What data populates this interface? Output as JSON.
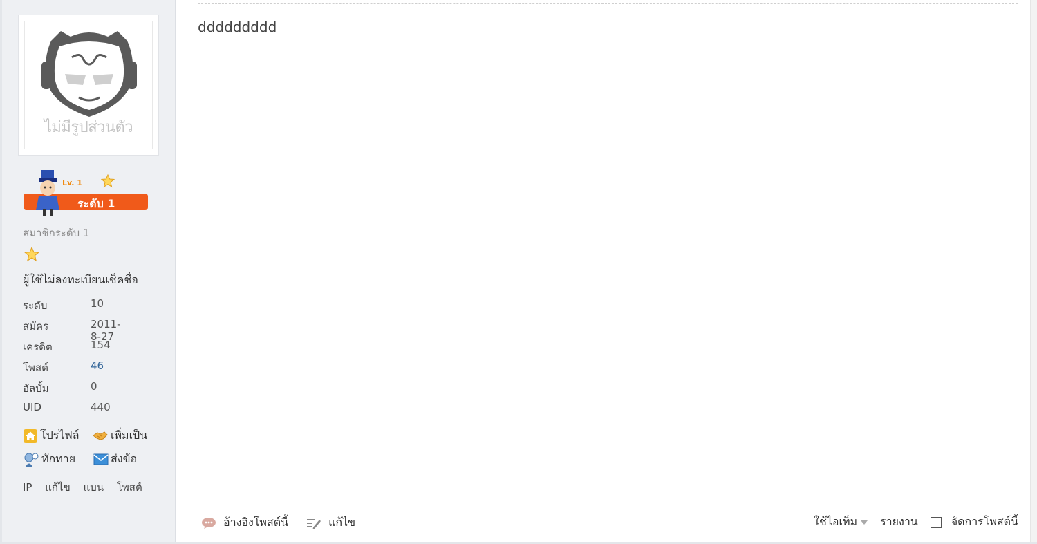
{
  "author": {
    "avatar_caption": "ไม่มีรูปส่วนตัว",
    "rank_mini": "Lv. 1",
    "rank_label": "ระดับ 1",
    "group_title": "สมาชิกระดับ 1",
    "custom_title": "ผู้ใช้ไม่ลงทะเบียนเช็คชื่อ",
    "stats": [
      {
        "label": "ระดับ",
        "value": "10"
      },
      {
        "label": "สมัคร",
        "value": "2011-8-27"
      },
      {
        "label": "เครดิต",
        "value": "154"
      },
      {
        "label": "โพสต์",
        "value": "46"
      },
      {
        "label": "อัลบั้ม",
        "value": "0"
      },
      {
        "label": "UID",
        "value": "440"
      }
    ],
    "actions": {
      "profile": "โปรไฟล์",
      "add_friend": "เพิ่มเป็น",
      "greet": "ทักทาย",
      "message": "ส่งข้อ"
    },
    "admin": {
      "ip": "IP",
      "edit": "แก้ไข",
      "ban": "แบน",
      "posts": "โพสต์"
    }
  },
  "post": {
    "body": "ddddddddd"
  },
  "footer": {
    "quote": "อ้างอิงโพสต์นี้",
    "edit": "แก้ไข",
    "use_item": "ใช้ไอเท็ม",
    "report": "รายงาน",
    "manage": "จัดการโพสต์นี้"
  },
  "colors": {
    "sidebar_bg": "#eef0f3",
    "rank_orange": "#f05a1a",
    "link_blue": "#336699"
  }
}
